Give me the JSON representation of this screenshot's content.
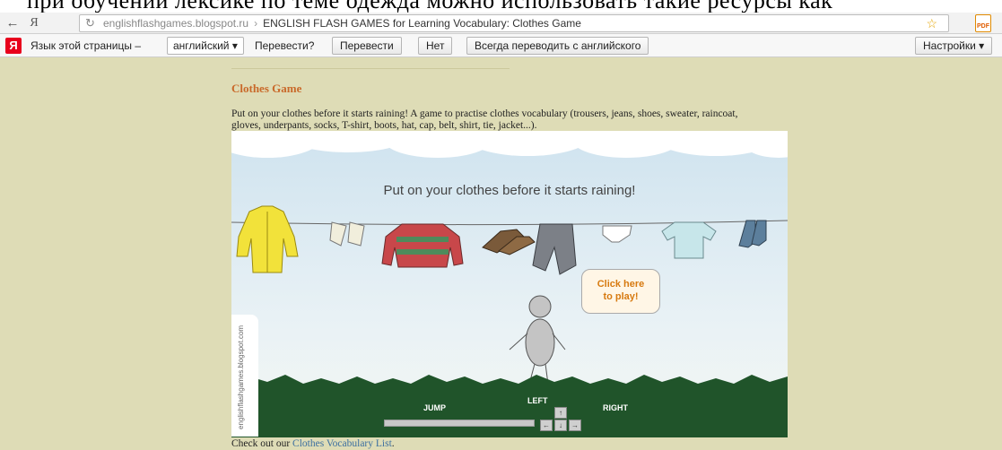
{
  "browser": {
    "header_text": "при обучении лексике по теме одежда можно использовать такие ресурсы как",
    "back_icon": "arrow-left-icon",
    "yandex_icon_label": "Я",
    "url_host": "englishflashgames.blogspot.ru",
    "url_separator": "›",
    "page_title": "ENGLISH FLASH GAMES for Learning Vocabulary: Clothes Game",
    "pdf_label": "PDF"
  },
  "translate_bar": {
    "logo": "Я",
    "lang_label": "Язык этой страницы –",
    "lang_value": "английский ▾",
    "question": "Перевести?",
    "translate_button": "Перевести",
    "no_button": "Нет",
    "always_button": "Всегда переводить с английского",
    "settings_button": "Настройки ▾"
  },
  "post": {
    "title": "Clothes Game",
    "description": "Put on your clothes before it starts raining! A game to practise clothes vocabulary (trousers, jeans, shoes, sweater, raincoat, gloves, underpants, socks, T-shirt, boots, hat, cap, belt, shirt, tie, jacket...).",
    "footer_prefix": "Check out our ",
    "footer_link": "Clothes Vocabulary List",
    "footer_suffix": "."
  },
  "game": {
    "heading": "Put on your clothes before it starts raining!",
    "bubble_line1": "Click here",
    "bubble_line2": "to play!",
    "watermark": "englishflashgames.blogspot.com",
    "jump_label": "JUMP",
    "left_label": "LEFT",
    "right_label": "RIGHT",
    "key_up": "↑",
    "key_left": "←",
    "key_down": "↓",
    "key_right": "→",
    "clothes": [
      "raincoat",
      "gloves",
      "sweater",
      "shoes",
      "trousers",
      "underpants",
      "T-shirt",
      "socks"
    ]
  }
}
